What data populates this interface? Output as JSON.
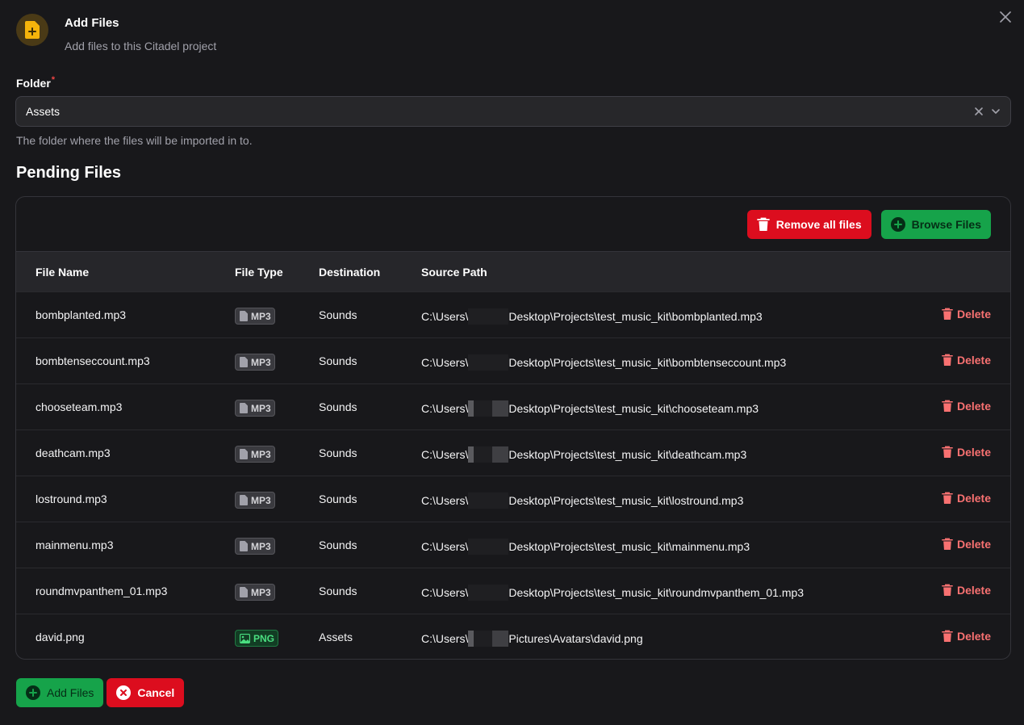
{
  "header": {
    "title": "Add Files",
    "subtitle": "Add files to this Citadel project",
    "icon": "file-plus-icon",
    "accent": "#f5b40b"
  },
  "folder": {
    "label": "Folder",
    "required_mark": "*",
    "value": "Assets",
    "helper": "The folder where the files will be imported in to."
  },
  "pending": {
    "title": "Pending Files",
    "remove_all_label": "Remove all files",
    "browse_label": "Browse Files",
    "columns": [
      "File Name",
      "File Type",
      "Destination",
      "Source Path"
    ],
    "rows": [
      {
        "name": "bombplanted.mp3",
        "type": "MP3",
        "dest": "Sounds",
        "path_prefix": "C:\\Users\\",
        "path_suffix": "Desktop\\Projects\\test_music_kit\\bombplanted.mp3",
        "delete": "Delete"
      },
      {
        "name": "bombtenseccount.mp3",
        "type": "MP3",
        "dest": "Sounds",
        "path_prefix": "C:\\Users\\",
        "path_suffix": "Desktop\\Projects\\test_music_kit\\bombtenseccount.mp3",
        "delete": "Delete"
      },
      {
        "name": "chooseteam.mp3",
        "type": "MP3",
        "dest": "Sounds",
        "path_prefix": "C:\\Users\\",
        "path_suffix": "Desktop\\Projects\\test_music_kit\\chooseteam.mp3",
        "delete": "Delete"
      },
      {
        "name": "deathcam.mp3",
        "type": "MP3",
        "dest": "Sounds",
        "path_prefix": "C:\\Users\\",
        "path_suffix": "Desktop\\Projects\\test_music_kit\\deathcam.mp3",
        "delete": "Delete"
      },
      {
        "name": "lostround.mp3",
        "type": "MP3",
        "dest": "Sounds",
        "path_prefix": "C:\\Users\\",
        "path_suffix": "Desktop\\Projects\\test_music_kit\\lostround.mp3",
        "delete": "Delete"
      },
      {
        "name": "mainmenu.mp3",
        "type": "MP3",
        "dest": "Sounds",
        "path_prefix": "C:\\Users\\",
        "path_suffix": "Desktop\\Projects\\test_music_kit\\mainmenu.mp3",
        "delete": "Delete"
      },
      {
        "name": "roundmvpanthem_01.mp3",
        "type": "MP3",
        "dest": "Sounds",
        "path_prefix": "C:\\Users\\",
        "path_suffix": "Desktop\\Projects\\test_music_kit\\roundmvpanthem_01.mp3",
        "delete": "Delete"
      },
      {
        "name": "david.png",
        "type": "PNG",
        "dest": "Assets",
        "path_prefix": "C:\\Users\\",
        "path_suffix": "Pictures\\Avatars\\david.png",
        "delete": "Delete"
      }
    ]
  },
  "footer": {
    "add_label": "Add Files",
    "cancel_label": "Cancel"
  },
  "colors": {
    "background": "#18181b",
    "danger": "#dc0d1e",
    "success": "#16a34a",
    "delete_text": "#f87171"
  }
}
